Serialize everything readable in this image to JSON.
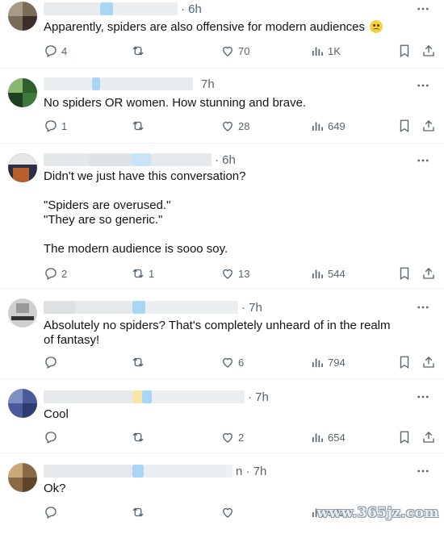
{
  "posts": [
    {
      "time": "· 6h",
      "text": "Apparently, spiders are also offensive for modern audiences",
      "emoji": "pleading-face",
      "reply_count": "4",
      "repost_count": "",
      "like_count": "70",
      "views": "1K"
    },
    {
      "time": "7h",
      "text": "No spiders OR women. How stunning and brave.",
      "reply_count": "1",
      "repost_count": "",
      "like_count": "28",
      "views": "649"
    },
    {
      "time": "· 6h",
      "text": "Didn't we just have this conversation?\n\n\"Spiders are overused.\"\n\"They are so generic.\"\n\nThe modern audience is sooo soy.",
      "reply_count": "2",
      "repost_count": "1",
      "like_count": "13",
      "views": "544"
    },
    {
      "time": "· 7h",
      "text": "Absolutely no spiders? That's completely unheard of in the realm of fantasy!",
      "reply_count": "",
      "repost_count": "",
      "like_count": "6",
      "views": "794"
    },
    {
      "time": "· 7h",
      "text": "Cool",
      "reply_count": "",
      "repost_count": "",
      "like_count": "2",
      "views": "654"
    },
    {
      "time": "n · 7h",
      "text": "Ok?",
      "reply_count": "",
      "repost_count": "",
      "like_count": "",
      "views": "542"
    }
  ],
  "watermark": "www.365jz.com",
  "colors": {
    "icon_gray": "#536471",
    "text": "#0f1419",
    "divider": "#eff3f4"
  }
}
